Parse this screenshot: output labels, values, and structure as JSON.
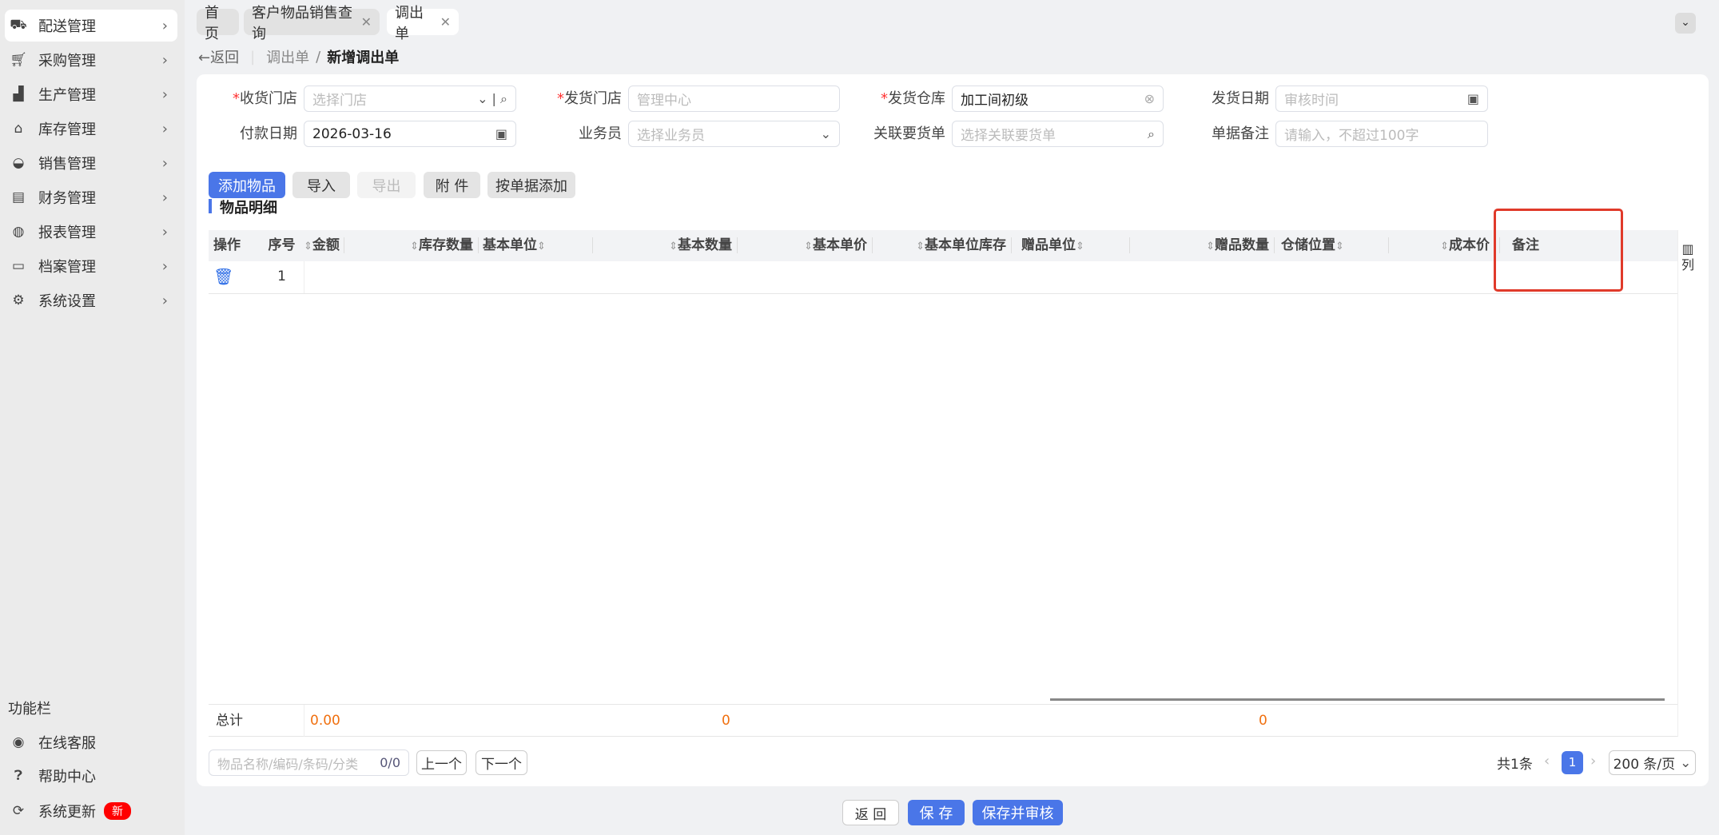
{
  "sidebar": {
    "items": [
      {
        "label": "配送管理",
        "icon": "truck-icon",
        "active": true
      },
      {
        "label": "采购管理",
        "icon": "cart-icon"
      },
      {
        "label": "生产管理",
        "icon": "factory-icon"
      },
      {
        "label": "库存管理",
        "icon": "warehouse-icon"
      },
      {
        "label": "销售管理",
        "icon": "bag-icon"
      },
      {
        "label": "财务管理",
        "icon": "receipt-icon"
      },
      {
        "label": "报表管理",
        "icon": "globe-icon"
      },
      {
        "label": "档案管理",
        "icon": "inbox-icon"
      },
      {
        "label": "系统设置",
        "icon": "gear-icon"
      }
    ],
    "section_title": "功能栏",
    "tools": [
      {
        "label": "在线客服",
        "icon": "headset-icon"
      },
      {
        "label": "帮助中心",
        "icon": "help-icon"
      },
      {
        "label": "系统更新",
        "icon": "refresh-icon",
        "badge": "新"
      }
    ]
  },
  "tabs": [
    {
      "label": "首页"
    },
    {
      "label": "客户物品销售查询",
      "closable": true
    },
    {
      "label": "调出单",
      "closable": true,
      "active": true
    }
  ],
  "breadcrumb": {
    "back": "返回",
    "parent": "调出单",
    "current": "新增调出单"
  },
  "form": {
    "receive_store": {
      "label": "收货门店",
      "placeholder": "选择门店",
      "required": true
    },
    "send_store": {
      "label": "发货门店",
      "placeholder": "管理中心",
      "required": true
    },
    "send_warehouse": {
      "label": "发货仓库",
      "value": "加工间初级",
      "required": true
    },
    "send_date": {
      "label": "发货日期",
      "placeholder": "审核时间"
    },
    "pay_date": {
      "label": "付款日期",
      "value": "2026-03-16"
    },
    "salesman": {
      "label": "业务员",
      "placeholder": "选择业务员"
    },
    "related_order": {
      "label": "关联要货单",
      "placeholder": "选择关联要货单"
    },
    "remark": {
      "label": "单据备注",
      "placeholder": "请输入，不超过100字"
    }
  },
  "toolbar": {
    "add": "添加物品",
    "import": "导入",
    "export": "导出",
    "attach": "附 件",
    "by_doc": "按单据添加"
  },
  "section": "物品明细",
  "table": {
    "columns": [
      "操作",
      "序号",
      "金额",
      "库存数量",
      "基本单位",
      "基本数量",
      "基本单价",
      "基本单位库存",
      "赠品单位",
      "赠品数量",
      "仓储位置",
      "成本价",
      "备注"
    ],
    "rows": [
      {
        "index": "1"
      }
    ],
    "column_toggle": "列",
    "total": {
      "label": "总计",
      "amount": "0.00",
      "base_qty": "0",
      "gift_qty": "0"
    }
  },
  "footer": {
    "search_placeholder": "物品名称/编码/条码/分类",
    "search_count": "0/0",
    "prev": "上一个",
    "next": "下一个",
    "total": "共1条",
    "page": "1",
    "page_size": "200 条/页"
  },
  "actions": {
    "back": "返 回",
    "save": "保 存",
    "save_audit": "保存并审核"
  },
  "colors": {
    "primary": "#4a76e8",
    "highlight_box": "#e03a2a",
    "total_value": "#f07010"
  }
}
